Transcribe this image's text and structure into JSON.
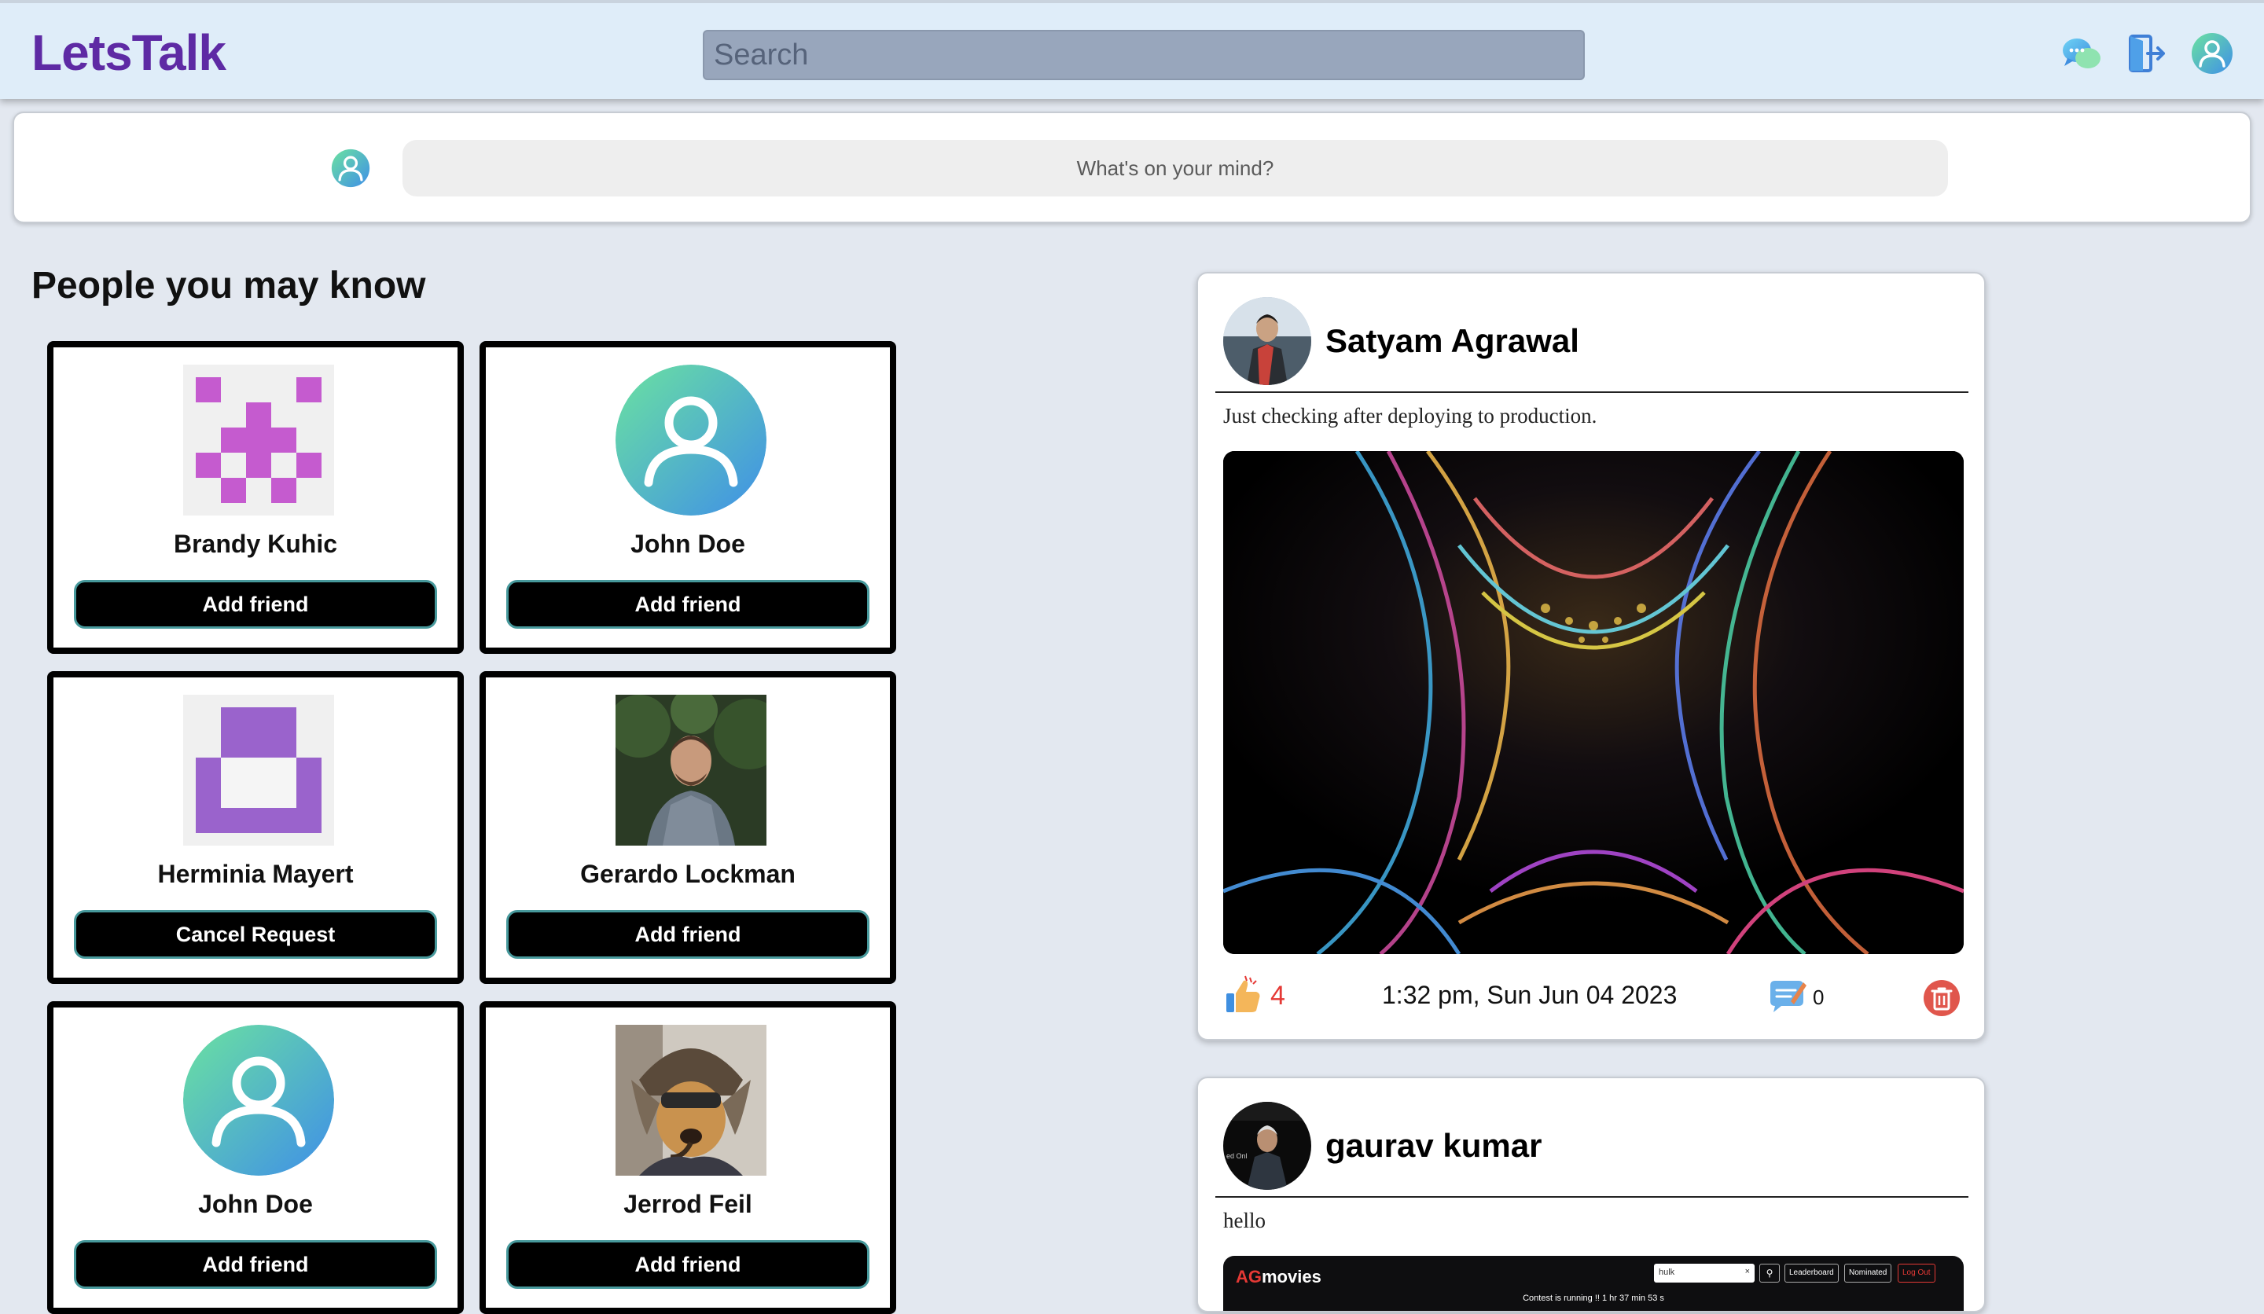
{
  "app": {
    "logo": "LetsTalk"
  },
  "header": {
    "search_placeholder": "Search",
    "icons": [
      "chat-icon",
      "logout-icon",
      "profile-icon"
    ]
  },
  "composer": {
    "placeholder": "What's on your mind?"
  },
  "pymk": {
    "title": "People you may know",
    "people": [
      {
        "name": "Brandy Kuhic",
        "button": "Add friend",
        "avatar": "identicon-magenta"
      },
      {
        "name": "John Doe",
        "button": "Add friend",
        "avatar": "default-avatar"
      },
      {
        "name": "Herminia Mayert",
        "button": "Cancel Request",
        "avatar": "identicon-purple"
      },
      {
        "name": "Gerardo Lockman",
        "button": "Add friend",
        "avatar": "photo-man"
      },
      {
        "name": "John Doe",
        "button": "Add friend",
        "avatar": "default-avatar"
      },
      {
        "name": "Jerrod Feil",
        "button": "Add friend",
        "avatar": "photo-dog"
      }
    ]
  },
  "posts": [
    {
      "author": "Satyam Agrawal",
      "text": "Just checking after deploying to production.",
      "likes": "4",
      "time": "1:32 pm, Sun Jun 04 2023",
      "comments": "0"
    },
    {
      "author": "gaurav kumar",
      "text": "hello",
      "embedded_site": {
        "brand_a": "AG",
        "brand_b": "movies",
        "search_value": "hulk",
        "buttons": [
          "Leaderboard",
          "Nominated",
          "Log Out"
        ],
        "banner": "Contest is running !! 1 hr 37 min 53 s"
      }
    }
  ],
  "colors": {
    "brand": "#5e2aa4",
    "header_bg": "#dfedf9",
    "page_bg": "#e3e8f0",
    "button_border": "#47999c",
    "likes": "#e53935"
  }
}
